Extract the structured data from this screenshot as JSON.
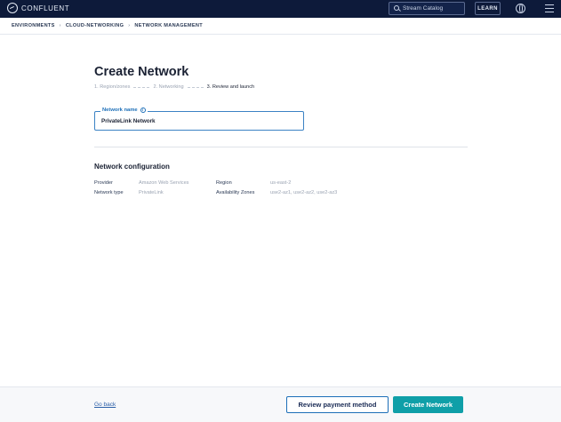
{
  "header": {
    "brand": "CONFLUENT",
    "search_placeholder": "Stream Catalog",
    "learn_label": "LEARN"
  },
  "breadcrumb": [
    "ENVIRONMENTS",
    "CLOUD-NETWORKING",
    "NETWORK MANAGEMENT"
  ],
  "page": {
    "title": "Create Network",
    "steps": [
      "1. Region/zones",
      "2. Networking",
      "3. Review and launch"
    ],
    "active_step": 3
  },
  "form": {
    "network_name_label": "Network name",
    "network_name_value": "PrivateLink Network"
  },
  "config": {
    "title": "Network configuration",
    "provider_label": "Provider",
    "provider_value": "Amazon Web Services",
    "network_type_label": "Network type",
    "network_type_value": "PrivateLink",
    "region_label": "Region",
    "region_value": "us-east-2",
    "zones_label": "Availability Zones",
    "zones_value": "use2-az1, use2-az2, use2-az3"
  },
  "footer": {
    "go_back": "Go back",
    "review_payment": "Review payment method",
    "create_network": "Create Network"
  },
  "colors": {
    "topbar": "#0d1a3a",
    "primary_button": "#0f9fa8",
    "accent_blue": "#1d6fb8"
  }
}
